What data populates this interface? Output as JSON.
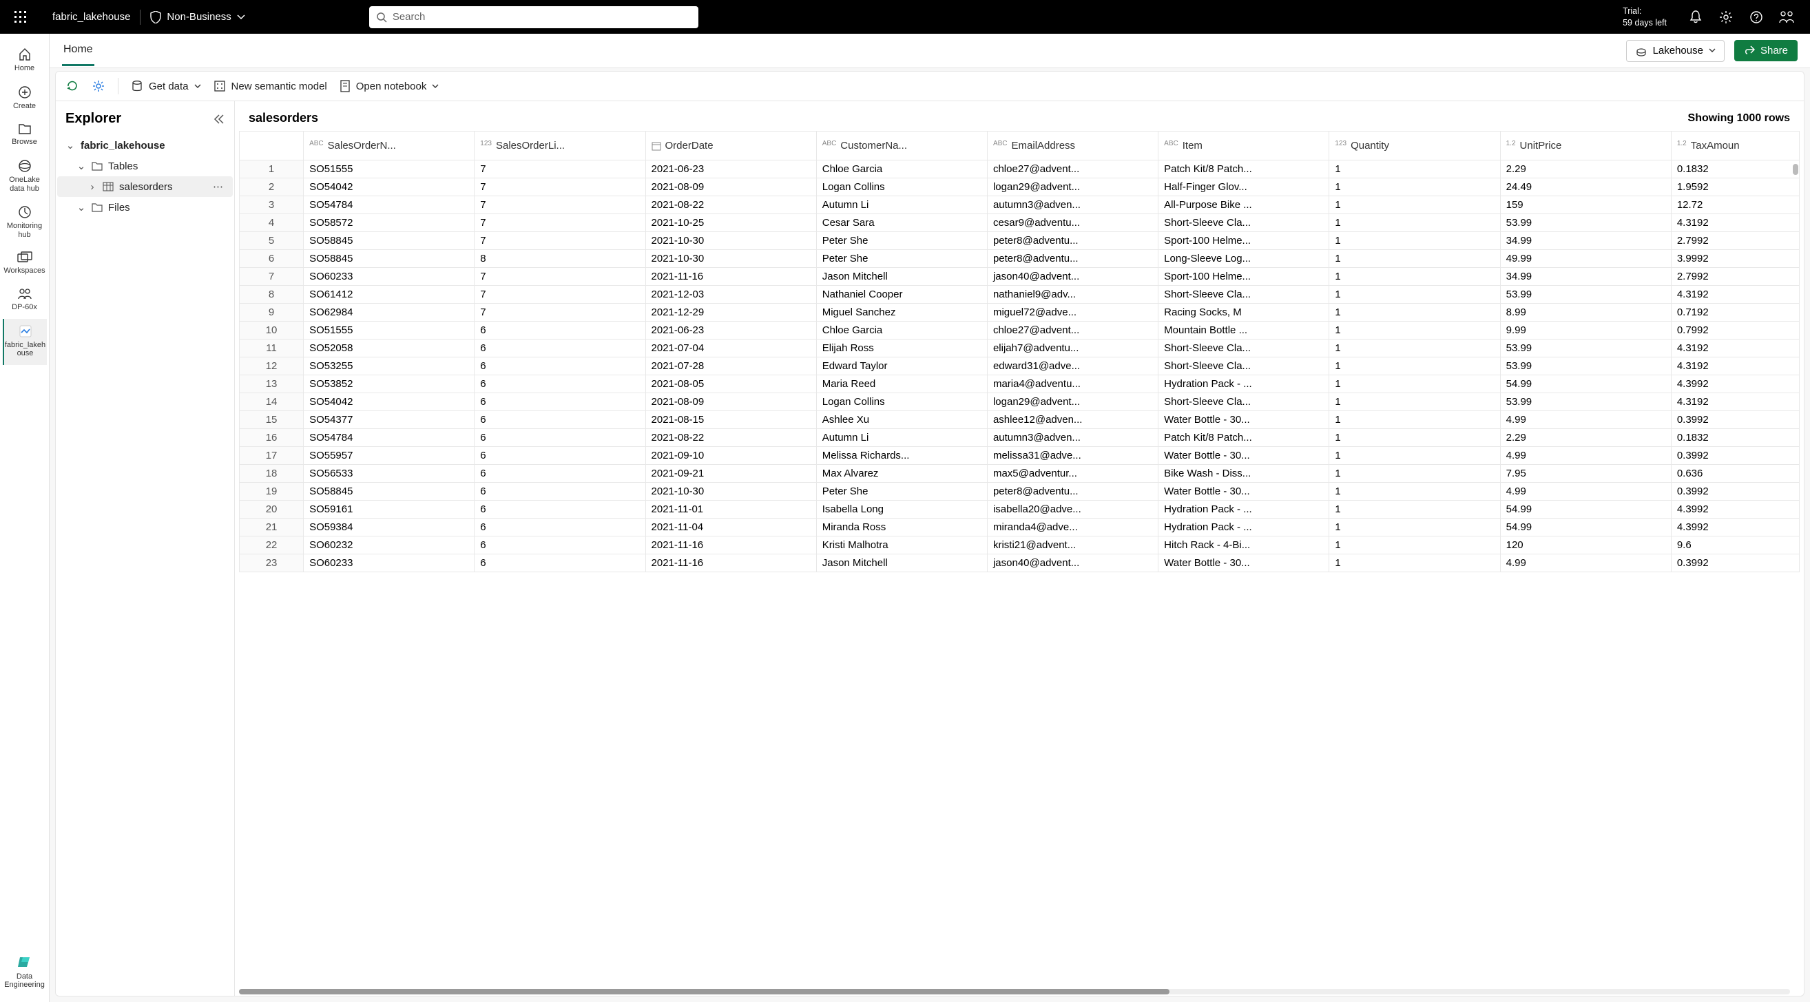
{
  "topbar": {
    "workspace_name": "fabric_lakehouse",
    "sensitivity_label": "Non-Business",
    "search_placeholder": "Search",
    "trial_line1": "Trial:",
    "trial_line2": "59 days left"
  },
  "leftrail": {
    "items": [
      {
        "label": "Home"
      },
      {
        "label": "Create"
      },
      {
        "label": "Browse"
      },
      {
        "label": "OneLake data hub"
      },
      {
        "label": "Monitoring hub"
      },
      {
        "label": "Workspaces"
      },
      {
        "label": "DP-60x"
      },
      {
        "label": "fabric_lakeh ouse"
      }
    ],
    "bottom_label": "Data Engineering"
  },
  "tabs": {
    "home": "Home"
  },
  "breadcrumb_actions": {
    "lakehouse": "Lakehouse",
    "share": "Share"
  },
  "toolbar": {
    "get_data": "Get data",
    "new_semantic_model": "New semantic model",
    "open_notebook": "Open notebook"
  },
  "explorer": {
    "title": "Explorer",
    "root": "fabric_lakehouse",
    "tables": "Tables",
    "salesorders": "salesorders",
    "files": "Files"
  },
  "data": {
    "table_name": "salesorders",
    "row_summary": "Showing 1000 rows",
    "columns": [
      {
        "type": "ABC",
        "name": "SalesOrderN..."
      },
      {
        "type": "123",
        "name": "SalesOrderLi..."
      },
      {
        "type": "cal",
        "name": "OrderDate"
      },
      {
        "type": "ABC",
        "name": "CustomerNa..."
      },
      {
        "type": "ABC",
        "name": "EmailAddress"
      },
      {
        "type": "ABC",
        "name": "Item"
      },
      {
        "type": "123",
        "name": "Quantity"
      },
      {
        "type": "1.2",
        "name": "UnitPrice"
      },
      {
        "type": "1.2",
        "name": "TaxAmoun"
      }
    ],
    "rows": [
      [
        "SO51555",
        "7",
        "2021-06-23",
        "Chloe Garcia",
        "chloe27@advent...",
        "Patch Kit/8 Patch...",
        "1",
        "2.29",
        "0.1832"
      ],
      [
        "SO54042",
        "7",
        "2021-08-09",
        "Logan Collins",
        "logan29@advent...",
        "Half-Finger Glov...",
        "1",
        "24.49",
        "1.9592"
      ],
      [
        "SO54784",
        "7",
        "2021-08-22",
        "Autumn Li",
        "autumn3@adven...",
        "All-Purpose Bike ...",
        "1",
        "159",
        "12.72"
      ],
      [
        "SO58572",
        "7",
        "2021-10-25",
        "Cesar Sara",
        "cesar9@adventu...",
        "Short-Sleeve Cla...",
        "1",
        "53.99",
        "4.3192"
      ],
      [
        "SO58845",
        "7",
        "2021-10-30",
        "Peter She",
        "peter8@adventu...",
        "Sport-100 Helme...",
        "1",
        "34.99",
        "2.7992"
      ],
      [
        "SO58845",
        "8",
        "2021-10-30",
        "Peter She",
        "peter8@adventu...",
        "Long-Sleeve Log...",
        "1",
        "49.99",
        "3.9992"
      ],
      [
        "SO60233",
        "7",
        "2021-11-16",
        "Jason Mitchell",
        "jason40@advent...",
        "Sport-100 Helme...",
        "1",
        "34.99",
        "2.7992"
      ],
      [
        "SO61412",
        "7",
        "2021-12-03",
        "Nathaniel Cooper",
        "nathaniel9@adv...",
        "Short-Sleeve Cla...",
        "1",
        "53.99",
        "4.3192"
      ],
      [
        "SO62984",
        "7",
        "2021-12-29",
        "Miguel Sanchez",
        "miguel72@adve...",
        "Racing Socks, M",
        "1",
        "8.99",
        "0.7192"
      ],
      [
        "SO51555",
        "6",
        "2021-06-23",
        "Chloe Garcia",
        "chloe27@advent...",
        "Mountain Bottle ...",
        "1",
        "9.99",
        "0.7992"
      ],
      [
        "SO52058",
        "6",
        "2021-07-04",
        "Elijah Ross",
        "elijah7@adventu...",
        "Short-Sleeve Cla...",
        "1",
        "53.99",
        "4.3192"
      ],
      [
        "SO53255",
        "6",
        "2021-07-28",
        "Edward Taylor",
        "edward31@adve...",
        "Short-Sleeve Cla...",
        "1",
        "53.99",
        "4.3192"
      ],
      [
        "SO53852",
        "6",
        "2021-08-05",
        "Maria Reed",
        "maria4@adventu...",
        "Hydration Pack - ...",
        "1",
        "54.99",
        "4.3992"
      ],
      [
        "SO54042",
        "6",
        "2021-08-09",
        "Logan Collins",
        "logan29@advent...",
        "Short-Sleeve Cla...",
        "1",
        "53.99",
        "4.3192"
      ],
      [
        "SO54377",
        "6",
        "2021-08-15",
        "Ashlee Xu",
        "ashlee12@adven...",
        "Water Bottle - 30...",
        "1",
        "4.99",
        "0.3992"
      ],
      [
        "SO54784",
        "6",
        "2021-08-22",
        "Autumn Li",
        "autumn3@adven...",
        "Patch Kit/8 Patch...",
        "1",
        "2.29",
        "0.1832"
      ],
      [
        "SO55957",
        "6",
        "2021-09-10",
        "Melissa Richards...",
        "melissa31@adve...",
        "Water Bottle - 30...",
        "1",
        "4.99",
        "0.3992"
      ],
      [
        "SO56533",
        "6",
        "2021-09-21",
        "Max Alvarez",
        "max5@adventur...",
        "Bike Wash - Diss...",
        "1",
        "7.95",
        "0.636"
      ],
      [
        "SO58845",
        "6",
        "2021-10-30",
        "Peter She",
        "peter8@adventu...",
        "Water Bottle - 30...",
        "1",
        "4.99",
        "0.3992"
      ],
      [
        "SO59161",
        "6",
        "2021-11-01",
        "Isabella Long",
        "isabella20@adve...",
        "Hydration Pack - ...",
        "1",
        "54.99",
        "4.3992"
      ],
      [
        "SO59384",
        "6",
        "2021-11-04",
        "Miranda Ross",
        "miranda4@adve...",
        "Hydration Pack - ...",
        "1",
        "54.99",
        "4.3992"
      ],
      [
        "SO60232",
        "6",
        "2021-11-16",
        "Kristi Malhotra",
        "kristi21@advent...",
        "Hitch Rack - 4-Bi...",
        "1",
        "120",
        "9.6"
      ],
      [
        "SO60233",
        "6",
        "2021-11-16",
        "Jason Mitchell",
        "jason40@advent...",
        "Water Bottle - 30...",
        "1",
        "4.99",
        "0.3992"
      ]
    ]
  }
}
